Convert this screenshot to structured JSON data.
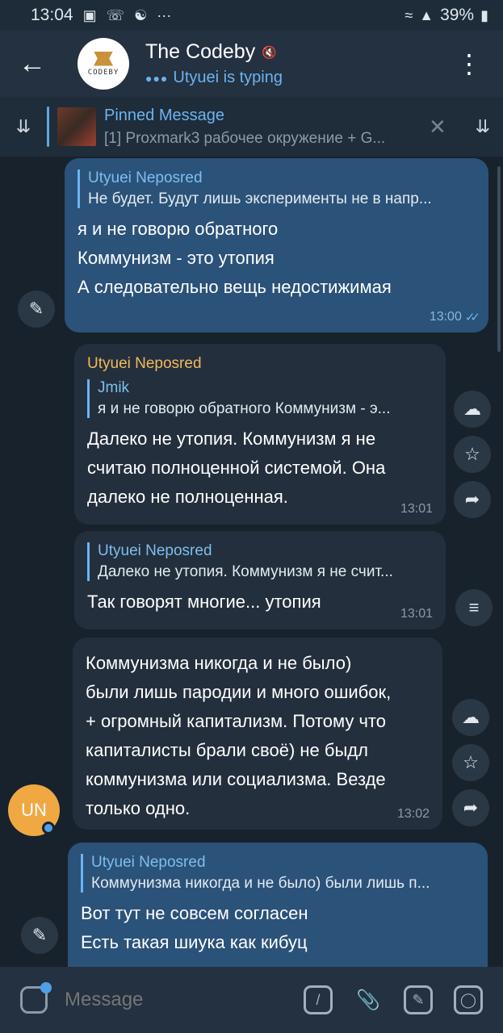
{
  "status_bar": {
    "time": "13:04",
    "notif_icons": [
      "notification-icon",
      "viber-icon",
      "app-icon"
    ],
    "more": "···",
    "battery": "39%"
  },
  "header": {
    "title": "The Codeby",
    "status": "Utyuei is typing",
    "avatar_text": "CODEBY",
    "icons": {
      "back": "arrow-left-icon",
      "mute": "mute-icon",
      "menu": "more-vert-icon"
    }
  },
  "pinned": {
    "title": "Pinned Message",
    "text": "[1] Proxmark3 рабочее окружение + G..."
  },
  "messages": [
    {
      "direction": "out",
      "quote_author": "Utyuei Neposred",
      "quote_text": "Не будет. Будут лишь эксперименты не в напр...",
      "lines": [
        "я и не говорю обратного",
        "Коммунизм - это утопия",
        "А следовательно вещь недостижимая"
      ],
      "time": "13:00"
    },
    {
      "direction": "in",
      "sender": "Utyuei Neposred",
      "quote_author": "Jmik",
      "quote_text": "я и не говорю обратного Коммунизм - э...",
      "lines": [
        "Далеко не утопия. Коммунизм я не",
        "считаю полноценной системой. Она",
        "далеко не полноценная."
      ],
      "time": "13:01"
    },
    {
      "direction": "in",
      "quote_author": "Utyuei Neposred",
      "quote_text": "Далеко не утопия. Коммунизм я не счит...",
      "lines": [
        "Так говорят многие... утопия"
      ],
      "time": "13:01"
    },
    {
      "direction": "in",
      "lines": [
        "Коммунизма никогда и не было)",
        "были лишь пародии и много ошибок,",
        "+ огромный капитализм. Потому что",
        "капиталисты брали своё) не быдл",
        "коммунизма или социализма. Везде",
        "только одно."
      ],
      "time": "13:02",
      "avatar_initials": "UN"
    },
    {
      "direction": "out",
      "quote_author": "Utyuei Neposred",
      "quote_text": "Коммунизма никогда и не было) были лишь п...",
      "lines": [
        "Вот тут не совсем согласен",
        "Есть такая шиука как кибуц"
      ]
    }
  ],
  "input_bar": {
    "placeholder": "Message",
    "icons": [
      "sticker-icon",
      "command-icon",
      "attach-icon",
      "sticker-pack-icon",
      "camera-icon"
    ]
  },
  "colors": {
    "background": "#18222d",
    "header": "#233141",
    "bubble_out": "#2b5279",
    "bubble_in": "#232f3c",
    "accent": "#6cb3f0",
    "sender_name": "#f2b95a",
    "avatar_un": "#f0a843"
  }
}
